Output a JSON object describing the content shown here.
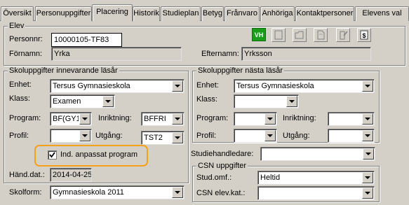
{
  "tabs": [
    {
      "label": "Översikt"
    },
    {
      "label": "Personuppgifter"
    },
    {
      "label": "Placering"
    },
    {
      "label": "Historik"
    },
    {
      "label": "Studieplan"
    },
    {
      "label": "Betyg"
    },
    {
      "label": "Frånvaro"
    },
    {
      "label": "Anhöriga"
    },
    {
      "label": "Kontaktpersoner"
    },
    {
      "label": "Elevens val"
    }
  ],
  "elev": {
    "title": "Elev",
    "personnr_label": "Personnr:",
    "personnr_value": "10000105-TF83",
    "fornamn_label": "Förnamn:",
    "fornamn_value": "Yrka",
    "efternamn_label": "Efternamn:",
    "efternamn_value": "Yrksson",
    "vh_badge": "VH"
  },
  "current": {
    "title": "Skoluppgifter innevarande läsår",
    "enhet_label": "Enhet:",
    "enhet_value": "Tersus Gymnasieskola",
    "klass_label": "Klass:",
    "klass_value": "Examen",
    "program_label": "Program:",
    "program_value": "BF(GY11",
    "inriktning_label": "Inriktning:",
    "inriktning_value": "BFFRI",
    "profil_label": "Profil:",
    "profil_value": "",
    "utgang_label": "Utgång:",
    "utgang_value": "TST2",
    "anpassat_label": "Ind. anpassat program",
    "anpassat_checked": true,
    "hand_dat_label": "Händ.dat.:",
    "hand_dat_value": "2014-04-25"
  },
  "skolform": {
    "label": "Skolform:",
    "value": "Gymnasieskola 2011"
  },
  "next": {
    "title": "Skoluppgifter nästa läsår",
    "enhet_label": "Enhet:",
    "enhet_value": "Tersus Gymnasieskola",
    "klass_label": "Klass:",
    "klass_value": "",
    "program_label": "Program:",
    "program_value": "",
    "inriktning_label": "Inriktning:",
    "inriktning_value": "",
    "profil_label": "Profil:",
    "profil_value": "",
    "utgang_label": "Utgång:",
    "utgang_value": ""
  },
  "studiehandledare": {
    "label": "Studiehandledare:",
    "value": ""
  },
  "csn": {
    "title": "CSN uppgifter",
    "studomf_label": "Stud.omf.:",
    "studomf_value": "Heltid",
    "csnelevkat_label": "CSN elev.kat.:",
    "csnelevkat_value": ""
  },
  "icons": [
    "blank-doc-icon",
    "open-folder-icon",
    "document-icon",
    "edit-document-icon",
    "dollar-document-icon"
  ]
}
